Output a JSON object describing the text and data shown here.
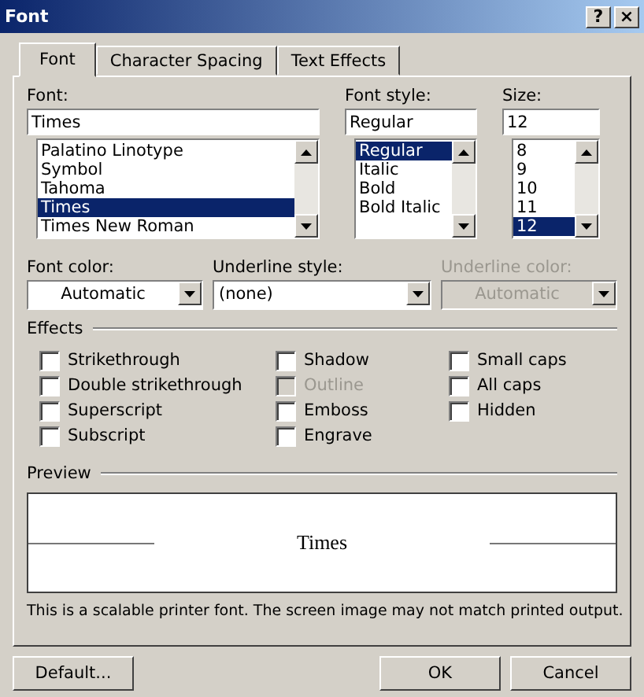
{
  "window": {
    "title": "Font",
    "help": "?",
    "close": "×"
  },
  "tabs": [
    {
      "label": "Font",
      "selected": true
    },
    {
      "label": "Character Spacing",
      "selected": false
    },
    {
      "label": "Text Effects",
      "selected": false
    }
  ],
  "pickers": [
    {
      "label": "Font:",
      "value": "Times",
      "items": [
        {
          "label": "Palatino Linotype",
          "selected": false
        },
        {
          "label": "Symbol",
          "selected": false
        },
        {
          "label": "Tahoma",
          "selected": false
        },
        {
          "label": "Times",
          "selected": true
        },
        {
          "label": "Times New Roman",
          "selected": false
        }
      ]
    },
    {
      "label": "Font style:",
      "value": "Regular",
      "items": [
        {
          "label": "Regular",
          "selected": true
        },
        {
          "label": "Italic",
          "selected": false
        },
        {
          "label": "Bold",
          "selected": false
        },
        {
          "label": "Bold Italic",
          "selected": false
        }
      ]
    },
    {
      "label": "Size:",
      "value": "12",
      "items": [
        {
          "label": "8",
          "selected": false
        },
        {
          "label": "9",
          "selected": false
        },
        {
          "label": "10",
          "selected": false
        },
        {
          "label": "11",
          "selected": false
        },
        {
          "label": "12",
          "selected": true
        }
      ]
    }
  ],
  "dropdowns": [
    {
      "label": "Font color:",
      "value": "Automatic",
      "disabled": false,
      "centered": true
    },
    {
      "label": "Underline style:",
      "value": "(none)",
      "disabled": false,
      "centered": false
    },
    {
      "label": "Underline color:",
      "value": "Automatic",
      "disabled": true,
      "centered": true
    }
  ],
  "effects": {
    "title": "Effects",
    "columns": [
      [
        {
          "label": "Strikethrough",
          "checked": false,
          "disabled": false
        },
        {
          "label": "Double strikethrough",
          "checked": false,
          "disabled": false
        },
        {
          "label": "Superscript",
          "checked": false,
          "disabled": false
        },
        {
          "label": "Subscript",
          "checked": false,
          "disabled": false
        }
      ],
      [
        {
          "label": "Shadow",
          "checked": false,
          "disabled": false
        },
        {
          "label": "Outline",
          "checked": false,
          "disabled": true
        },
        {
          "label": "Emboss",
          "checked": false,
          "disabled": false
        },
        {
          "label": "Engrave",
          "checked": false,
          "disabled": false
        }
      ],
      [
        {
          "label": "Small caps",
          "checked": false,
          "disabled": false
        },
        {
          "label": "All caps",
          "checked": false,
          "disabled": false
        },
        {
          "label": "Hidden",
          "checked": false,
          "disabled": false
        }
      ]
    ]
  },
  "preview": {
    "title": "Preview",
    "sample": "Times"
  },
  "note": "This is a scalable printer font. The screen image may not match printed output.",
  "buttons": [
    "Default...",
    "OK",
    "Cancel"
  ]
}
